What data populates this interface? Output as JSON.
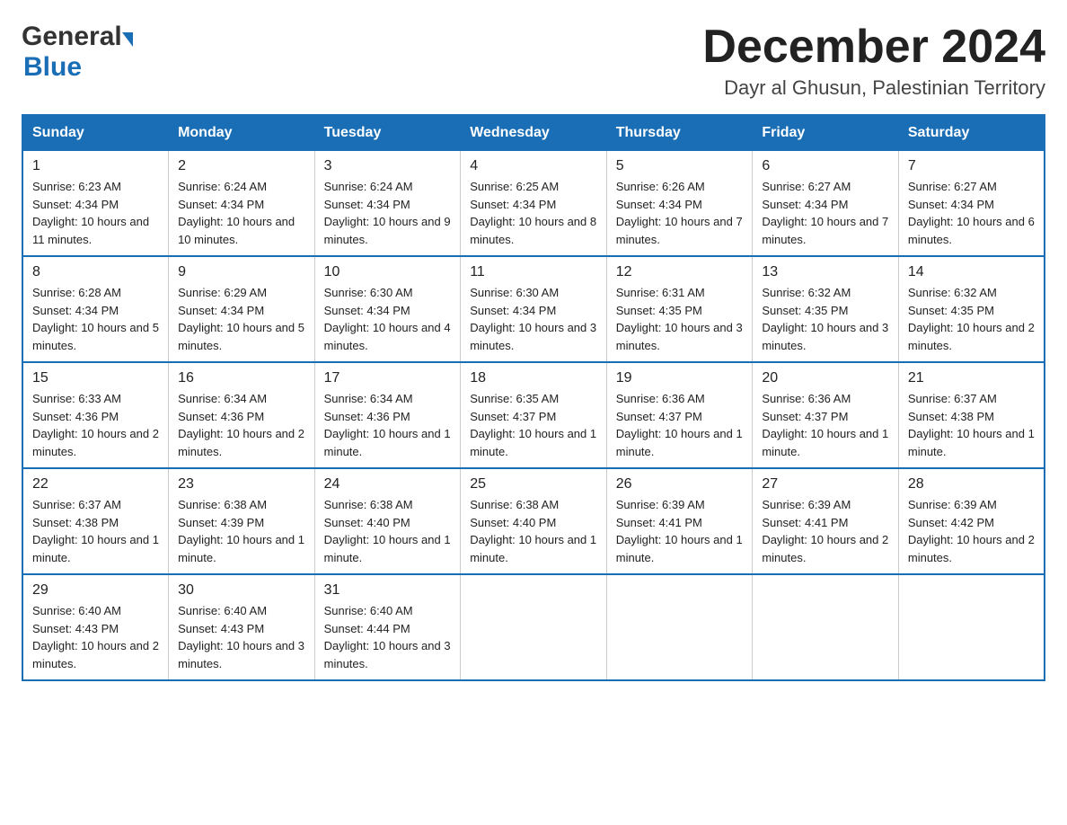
{
  "header": {
    "logo_general": "General",
    "logo_blue": "Blue",
    "month_title": "December 2024",
    "subtitle": "Dayr al Ghusun, Palestinian Territory"
  },
  "days_of_week": [
    "Sunday",
    "Monday",
    "Tuesday",
    "Wednesday",
    "Thursday",
    "Friday",
    "Saturday"
  ],
  "weeks": [
    [
      {
        "day": "1",
        "sunrise": "6:23 AM",
        "sunset": "4:34 PM",
        "daylight": "10 hours and 11 minutes."
      },
      {
        "day": "2",
        "sunrise": "6:24 AM",
        "sunset": "4:34 PM",
        "daylight": "10 hours and 10 minutes."
      },
      {
        "day": "3",
        "sunrise": "6:24 AM",
        "sunset": "4:34 PM",
        "daylight": "10 hours and 9 minutes."
      },
      {
        "day": "4",
        "sunrise": "6:25 AM",
        "sunset": "4:34 PM",
        "daylight": "10 hours and 8 minutes."
      },
      {
        "day": "5",
        "sunrise": "6:26 AM",
        "sunset": "4:34 PM",
        "daylight": "10 hours and 7 minutes."
      },
      {
        "day": "6",
        "sunrise": "6:27 AM",
        "sunset": "4:34 PM",
        "daylight": "10 hours and 7 minutes."
      },
      {
        "day": "7",
        "sunrise": "6:27 AM",
        "sunset": "4:34 PM",
        "daylight": "10 hours and 6 minutes."
      }
    ],
    [
      {
        "day": "8",
        "sunrise": "6:28 AM",
        "sunset": "4:34 PM",
        "daylight": "10 hours and 5 minutes."
      },
      {
        "day": "9",
        "sunrise": "6:29 AM",
        "sunset": "4:34 PM",
        "daylight": "10 hours and 5 minutes."
      },
      {
        "day": "10",
        "sunrise": "6:30 AM",
        "sunset": "4:34 PM",
        "daylight": "10 hours and 4 minutes."
      },
      {
        "day": "11",
        "sunrise": "6:30 AM",
        "sunset": "4:34 PM",
        "daylight": "10 hours and 3 minutes."
      },
      {
        "day": "12",
        "sunrise": "6:31 AM",
        "sunset": "4:35 PM",
        "daylight": "10 hours and 3 minutes."
      },
      {
        "day": "13",
        "sunrise": "6:32 AM",
        "sunset": "4:35 PM",
        "daylight": "10 hours and 3 minutes."
      },
      {
        "day": "14",
        "sunrise": "6:32 AM",
        "sunset": "4:35 PM",
        "daylight": "10 hours and 2 minutes."
      }
    ],
    [
      {
        "day": "15",
        "sunrise": "6:33 AM",
        "sunset": "4:36 PM",
        "daylight": "10 hours and 2 minutes."
      },
      {
        "day": "16",
        "sunrise": "6:34 AM",
        "sunset": "4:36 PM",
        "daylight": "10 hours and 2 minutes."
      },
      {
        "day": "17",
        "sunrise": "6:34 AM",
        "sunset": "4:36 PM",
        "daylight": "10 hours and 1 minute."
      },
      {
        "day": "18",
        "sunrise": "6:35 AM",
        "sunset": "4:37 PM",
        "daylight": "10 hours and 1 minute."
      },
      {
        "day": "19",
        "sunrise": "6:36 AM",
        "sunset": "4:37 PM",
        "daylight": "10 hours and 1 minute."
      },
      {
        "day": "20",
        "sunrise": "6:36 AM",
        "sunset": "4:37 PM",
        "daylight": "10 hours and 1 minute."
      },
      {
        "day": "21",
        "sunrise": "6:37 AM",
        "sunset": "4:38 PM",
        "daylight": "10 hours and 1 minute."
      }
    ],
    [
      {
        "day": "22",
        "sunrise": "6:37 AM",
        "sunset": "4:38 PM",
        "daylight": "10 hours and 1 minute."
      },
      {
        "day": "23",
        "sunrise": "6:38 AM",
        "sunset": "4:39 PM",
        "daylight": "10 hours and 1 minute."
      },
      {
        "day": "24",
        "sunrise": "6:38 AM",
        "sunset": "4:40 PM",
        "daylight": "10 hours and 1 minute."
      },
      {
        "day": "25",
        "sunrise": "6:38 AM",
        "sunset": "4:40 PM",
        "daylight": "10 hours and 1 minute."
      },
      {
        "day": "26",
        "sunrise": "6:39 AM",
        "sunset": "4:41 PM",
        "daylight": "10 hours and 1 minute."
      },
      {
        "day": "27",
        "sunrise": "6:39 AM",
        "sunset": "4:41 PM",
        "daylight": "10 hours and 2 minutes."
      },
      {
        "day": "28",
        "sunrise": "6:39 AM",
        "sunset": "4:42 PM",
        "daylight": "10 hours and 2 minutes."
      }
    ],
    [
      {
        "day": "29",
        "sunrise": "6:40 AM",
        "sunset": "4:43 PM",
        "daylight": "10 hours and 2 minutes."
      },
      {
        "day": "30",
        "sunrise": "6:40 AM",
        "sunset": "4:43 PM",
        "daylight": "10 hours and 3 minutes."
      },
      {
        "day": "31",
        "sunrise": "6:40 AM",
        "sunset": "4:44 PM",
        "daylight": "10 hours and 3 minutes."
      },
      null,
      null,
      null,
      null
    ]
  ]
}
